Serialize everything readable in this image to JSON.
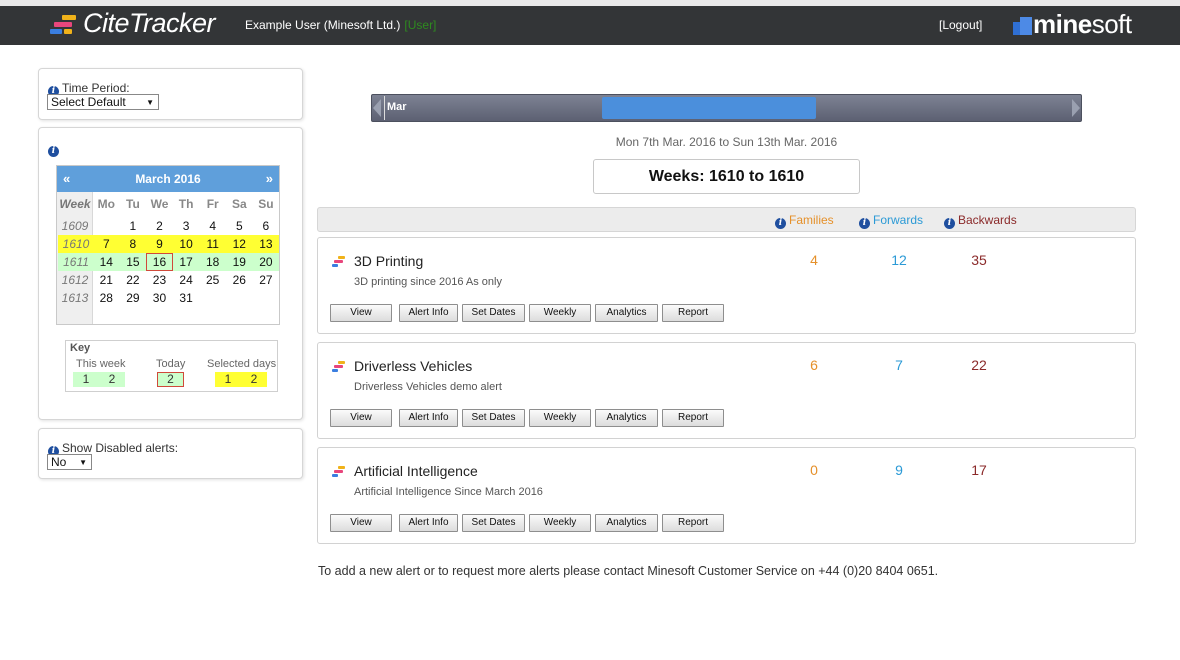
{
  "header": {
    "app_name": "CiteTracker",
    "user": "Example User (Minesoft Ltd.)",
    "role": "[User]",
    "logout_label": "[Logout]",
    "brand_bold": "mine",
    "brand_light": "soft"
  },
  "colors": {
    "header_bg": "#333537",
    "accent_blue": "#5f9fdb",
    "families": "#e5902a",
    "forwards": "#2b9ad6",
    "backwards": "#8b2a2a",
    "selected_week": "#ffff33",
    "this_week": "#ccffcc"
  },
  "time_period": {
    "label": "Time Period:",
    "selected": "Select Default"
  },
  "calendar": {
    "prev": "«",
    "next": "»",
    "month_label": "March 2016",
    "headers": [
      "Week",
      "Mo",
      "Tu",
      "We",
      "Th",
      "Fr",
      "Sa",
      "Su"
    ],
    "rows": [
      {
        "week": "1609",
        "days": [
          "",
          "1",
          "2",
          "3",
          "4",
          "5",
          "6"
        ],
        "state": "normal"
      },
      {
        "week": "1610",
        "days": [
          "7",
          "8",
          "9",
          "10",
          "11",
          "12",
          "13"
        ],
        "state": "selected"
      },
      {
        "week": "1611",
        "days": [
          "14",
          "15",
          "16",
          "17",
          "18",
          "19",
          "20"
        ],
        "state": "thisweek",
        "today_index": 2
      },
      {
        "week": "1612",
        "days": [
          "21",
          "22",
          "23",
          "24",
          "25",
          "26",
          "27"
        ],
        "state": "normal"
      },
      {
        "week": "1613",
        "days": [
          "28",
          "29",
          "30",
          "31",
          "",
          "",
          ""
        ],
        "state": "normal"
      }
    ],
    "key": {
      "title": "Key",
      "this_week_label": "This week",
      "today_label": "Today",
      "selected_label": "Selected days",
      "this_week_values": [
        "1",
        "2"
      ],
      "today_value": "2",
      "selected_values": [
        "1",
        "2"
      ]
    }
  },
  "disabled_alerts": {
    "label": "Show Disabled alerts:",
    "selected": "No"
  },
  "timeline": {
    "month": "Mar",
    "date_range": "Mon 7th Mar. 2016 to Sun 13th Mar. 2016",
    "weeks_label": "Weeks: 1610 to 1610"
  },
  "columns": {
    "families": "Families",
    "forwards": "Forwards",
    "backwards": "Backwards"
  },
  "alert_buttons": [
    "View",
    "Alert Info",
    "Set Dates",
    "Weekly",
    "Analytics",
    "Report"
  ],
  "alerts": [
    {
      "title": "3D Printing",
      "description": "3D printing since 2016 As only",
      "families": "4",
      "forwards": "12",
      "backwards": "35"
    },
    {
      "title": "Driverless Vehicles",
      "description": "Driverless Vehicles demo alert",
      "families": "6",
      "forwards": "7",
      "backwards": "22"
    },
    {
      "title": "Artificial Intelligence",
      "description": "Artificial Intelligence Since March 2016",
      "families": "0",
      "forwards": "9",
      "backwards": "17"
    }
  ],
  "footer_note": "To add a new alert or to request more alerts please contact Minesoft Customer Service on +44 (0)20 8404 0651."
}
